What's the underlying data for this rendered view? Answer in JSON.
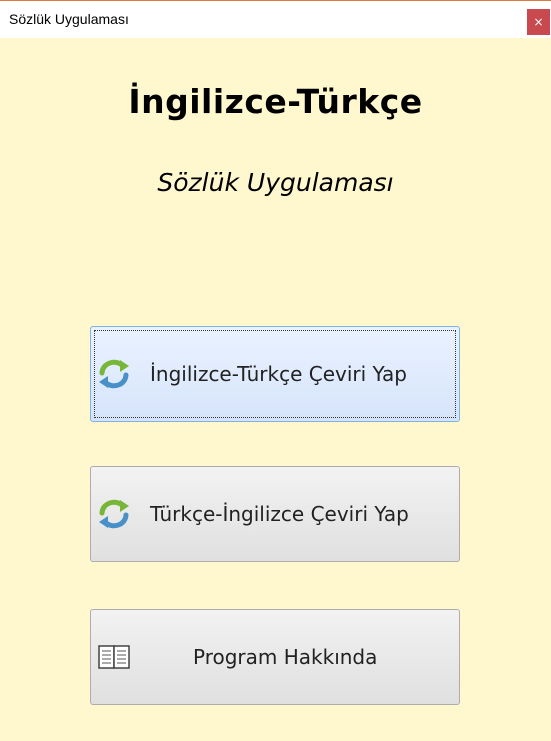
{
  "window": {
    "title": "Sözlük Uygulaması",
    "close_glyph": "×"
  },
  "header": {
    "main_title": "İngilizce-Türkçe",
    "subtitle": "Sözlük Uygulaması"
  },
  "buttons": [
    {
      "label": "İngilizce-Türkçe Çeviri Yap",
      "icon": "refresh-icon"
    },
    {
      "label": "Türkçe-İngilizce Çeviri Yap",
      "icon": "refresh-icon"
    },
    {
      "label": "Program Hakkında",
      "icon": "book-icon"
    }
  ],
  "colors": {
    "background": "#fff8cf",
    "close_button": "#c94a4e",
    "focused_button": "#d6e4fb"
  }
}
